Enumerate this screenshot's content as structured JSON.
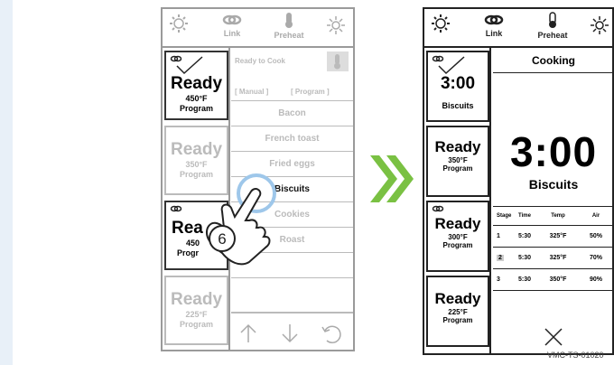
{
  "left_screen": {
    "topbar": {
      "link_label": "Link",
      "preheat_label": "Preheat"
    },
    "slots": [
      {
        "status": "Ready",
        "temp": "450°F",
        "mode": "Program"
      },
      {
        "status": "Ready",
        "temp": "350°F",
        "mode": "Program"
      },
      {
        "status": "Rea",
        "temp": "450",
        "mode": "Progr"
      },
      {
        "status": "Ready",
        "temp": "225°F",
        "mode": "Program"
      }
    ],
    "header": "Ready to Cook",
    "tabs": {
      "manual": "[ Manual ]",
      "program": "[ Program ]"
    },
    "items": [
      "Bacon",
      "French toast",
      "Fried eggs",
      "Biscuits",
      "Cookies",
      "Roast"
    ],
    "step_number": "6"
  },
  "right_screen": {
    "topbar": {
      "link_label": "Link",
      "preheat_label": "Preheat"
    },
    "slots": [
      {
        "status": "3:00",
        "temp": "",
        "mode": "Biscuits"
      },
      {
        "status": "Ready",
        "temp": "350°F",
        "mode": "Program"
      },
      {
        "status": "Ready",
        "temp": "300°F",
        "mode": "Program"
      },
      {
        "status": "Ready",
        "temp": "225°F",
        "mode": "Program"
      }
    ],
    "header": "Cooking",
    "big_time": "3:00",
    "big_name": "Biscuits",
    "table": {
      "headers": [
        "Stage",
        "Time",
        "Temp",
        "Air"
      ],
      "rows": [
        [
          "1",
          "5:30",
          "325°F",
          "50%"
        ],
        [
          "2",
          "5:30",
          "325°F",
          "70%"
        ],
        [
          "3",
          "5:30",
          "350°F",
          "90%"
        ]
      ]
    }
  },
  "caption": "VMC-TS-01020",
  "colors": {
    "arrow_green": "#7ac143"
  }
}
